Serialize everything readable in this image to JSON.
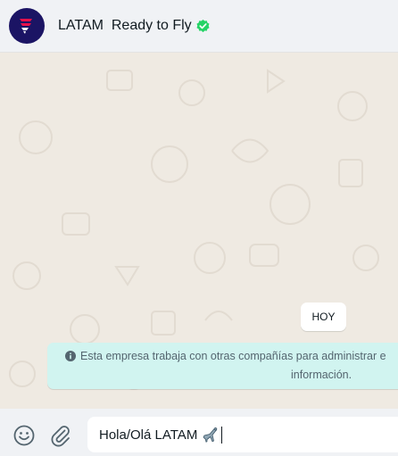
{
  "header": {
    "contact_name": "LATAM  Ready to Fly",
    "avatar_icon": "latam-logo",
    "verified_icon": "verified-badge-icon",
    "colors": {
      "avatar": "#1b1464",
      "verified": "#25d366"
    }
  },
  "chat": {
    "day_label": "HOY",
    "notice": {
      "icon": "info-icon",
      "line1": "Esta empresa trabaja con otras compañías para administrar e",
      "line2": "información."
    },
    "colors": {
      "wallpaper": "#efeae2",
      "notice_bg": "#d1f4f0"
    }
  },
  "composer": {
    "text": "Hola/Olá LATAM",
    "emoji": "airplane",
    "emoji_button_icon": "smiley-icon",
    "attach_button_icon": "paperclip-icon"
  }
}
